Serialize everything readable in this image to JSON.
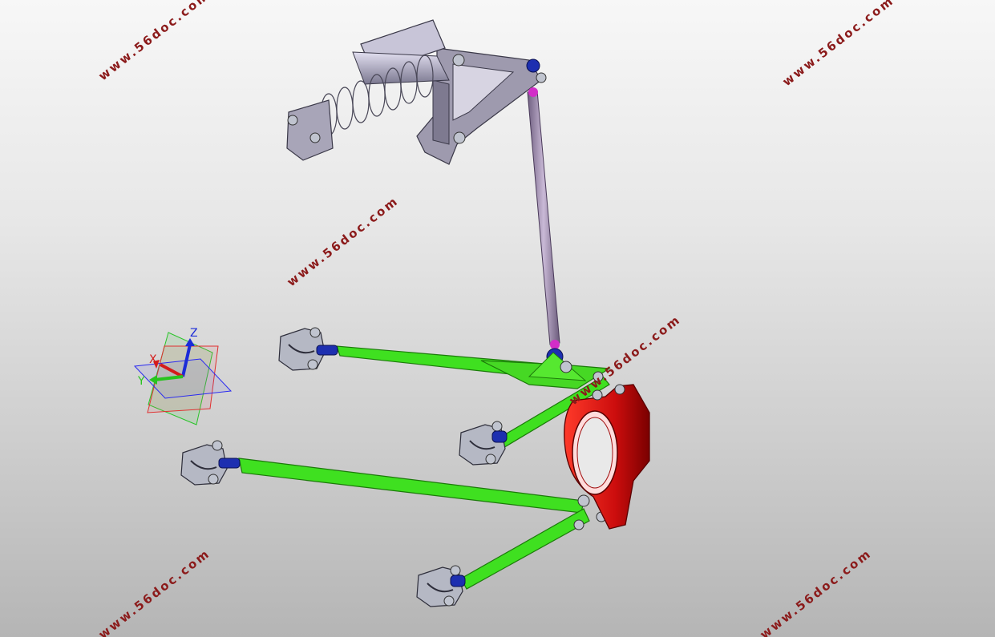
{
  "watermark": "www.56doc.com",
  "axes": {
    "x": "X",
    "y": "Y",
    "z": "Z"
  },
  "colors": {
    "link_green": "#3fe020",
    "upright_red": "#d40a0a",
    "pushrod": "#9b86a8",
    "damper": "#b7b3c7",
    "joint_blue": "#1d2fb0",
    "watermark": "#8b1a1a"
  },
  "icons": {
    "compass": "xyz-axis-triad-icon"
  }
}
